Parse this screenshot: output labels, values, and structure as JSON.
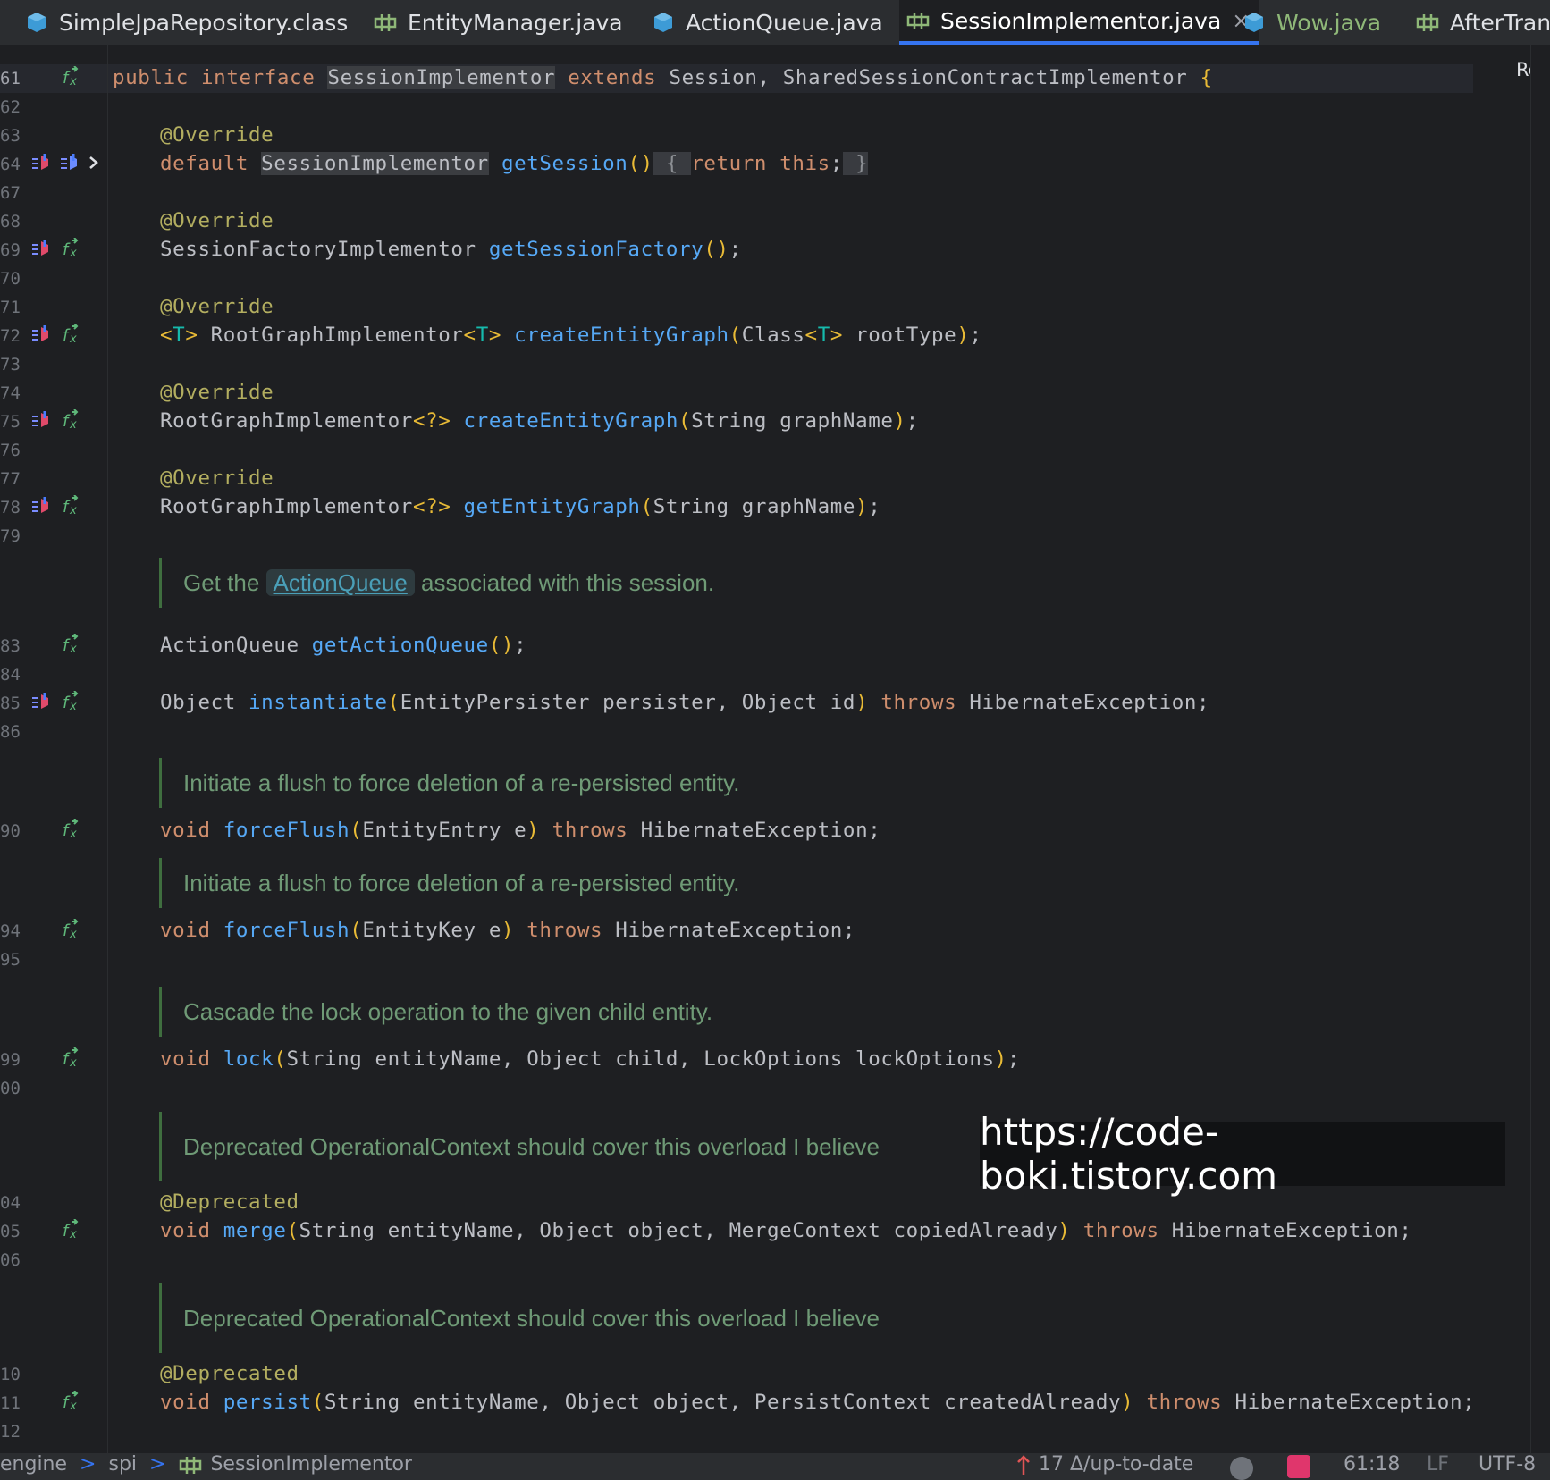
{
  "tabs": [
    {
      "label": "SimpleJpaRepository.class",
      "icon": "class-icon"
    },
    {
      "label": "EntityManager.java",
      "icon": "interface-icon"
    },
    {
      "label": "ActionQueue.java",
      "icon": "class-icon"
    },
    {
      "label": "SessionImplementor.java",
      "icon": "interface-icon",
      "active": true,
      "close": "×"
    },
    {
      "label": "Wow.java",
      "icon": "class-icon"
    },
    {
      "label": "AfterTrans",
      "icon": "interface-icon"
    }
  ],
  "reader_mode": "Rea",
  "line_numbers": [
    "61",
    "62",
    "63",
    "64",
    "67",
    "68",
    "69",
    "70",
    "71",
    "72",
    "73",
    "74",
    "75",
    "76",
    "77",
    "78",
    "79",
    "83",
    "84",
    "85",
    "86",
    "90",
    "94",
    "95",
    "99",
    "00",
    "04",
    "05",
    "06",
    "10",
    "11",
    "12"
  ],
  "code": {
    "l61": {
      "kw": "public interface ",
      "name": "SessionImplementor",
      "ext": " extends ",
      "rest": "Session, SharedSessionContractImplementor ",
      "brace": "{"
    },
    "override": "@Override",
    "deprecated": "@Deprecated",
    "l64": {
      "kw": "default ",
      "type": "SessionImplementor",
      "fn": "getSession",
      "p": "()",
      "fold_open": " { ",
      "ret": "return this",
      "semi": ";",
      "fold_close": " }"
    },
    "l69": {
      "type": "SessionFactoryImplementor ",
      "fn": "getSessionFactory",
      "p": "()",
      "semi": ";"
    },
    "l72": {
      "g1": "<",
      "t1": "T",
      "g2": "> ",
      "type": "RootGraphImplementor",
      "g3": "<",
      "t2": "T",
      "g4": "> ",
      "fn": "createEntityGraph",
      "p1": "(",
      "arg1": "Class",
      "g5": "<",
      "t3": "T",
      "g6": ">",
      "arg2": " rootType",
      "p2": ")",
      "semi": ";"
    },
    "l75": {
      "type": "RootGraphImplementor",
      "wild": "<?> ",
      "fn": "createEntityGraph",
      "p1": "(",
      "args": "String graphName",
      "p2": ")",
      "semi": ";"
    },
    "l78": {
      "type": "RootGraphImplementor",
      "wild": "<?> ",
      "fn": "getEntityGraph",
      "p1": "(",
      "args": "String graphName",
      "p2": ")",
      "semi": ";"
    },
    "doc1": {
      "pre": "Get the ",
      "link": "ActionQueue",
      "post": " associated with this session."
    },
    "l83": {
      "type": "ActionQueue ",
      "fn": "getActionQueue",
      "p": "()",
      "semi": ";"
    },
    "l85": {
      "type": "Object ",
      "fn": "instantiate",
      "p1": "(",
      "args": "EntityPersister persister, Object id",
      "p2": ")",
      "throws": " throws ",
      "exc": "HibernateException;"
    },
    "doc2": "Initiate a flush to force deletion of a re-persisted entity.",
    "l90": {
      "type": "void ",
      "fn": "forceFlush",
      "p1": "(",
      "args": "EntityEntry e",
      "p2": ")",
      "throws": " throws ",
      "exc": "HibernateException;"
    },
    "doc3": "Initiate a flush to force deletion of a re-persisted entity.",
    "l94": {
      "type": "void ",
      "fn": "forceFlush",
      "p1": "(",
      "args": "EntityKey e",
      "p2": ")",
      "throws": " throws ",
      "exc": "HibernateException;"
    },
    "doc4": "Cascade the lock operation to the given child entity.",
    "l99": {
      "type": "void ",
      "fn": "lock",
      "p1": "(",
      "args": "String entityName, Object child, LockOptions lockOptions",
      "p2": ")",
      "semi": ";"
    },
    "doc5": "Deprecated OperationalContext should cover this overload I believe",
    "l105": {
      "type": "void ",
      "fn": "merge",
      "p1": "(",
      "args": "String entityName, Object object, MergeContext copiedAlready",
      "p2": ")",
      "throws": " throws ",
      "exc": "HibernateException;"
    },
    "doc6": "Deprecated OperationalContext should cover this overload I believe",
    "l111": {
      "type": "void ",
      "fn": "persist",
      "p1": "(",
      "args": "String entityName, Object object, PersistContext createdAlready",
      "p2": ")",
      "throws": " throws ",
      "exc": "HibernateException;"
    }
  },
  "watermark": "https://code-boki.tistory.com",
  "status": {
    "bc1": "engine",
    "bc2": "spi",
    "bc3": "SessionImplementor",
    "sep": ">",
    "vcs": "17 Δ/up-to-date",
    "position": "61:18",
    "line_sep": "LF",
    "encoding": "UTF-8"
  },
  "colors": {
    "accent": "#3574f0",
    "keyword": "#cf8e6d",
    "function": "#56a8f5",
    "annotation": "#b3ae60",
    "doc": "#6f9a76"
  }
}
